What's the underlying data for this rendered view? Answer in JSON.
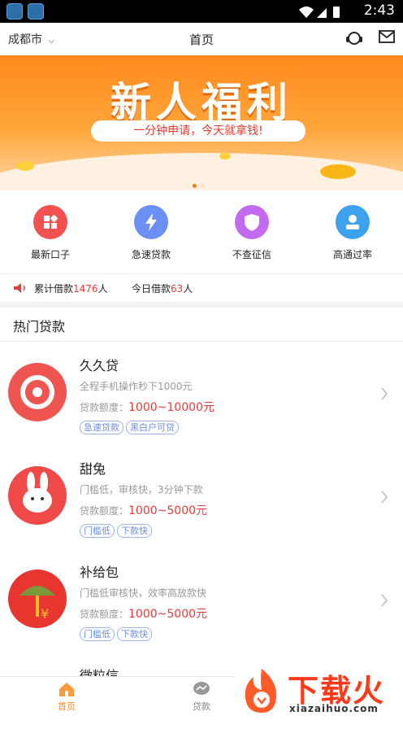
{
  "status_bar": {
    "time": "2:43"
  },
  "header": {
    "city": "成都市",
    "title": "首页"
  },
  "banner": {
    "title": "新人福利",
    "subtitle": "一分钟申请，今天就拿钱!"
  },
  "quick_links": [
    {
      "label": "最新口子",
      "color": "#f2514f"
    },
    {
      "label": "急速贷款",
      "color": "#6b8ff2"
    },
    {
      "label": "不查征信",
      "color": "#c36bf0"
    },
    {
      "label": "高通过率",
      "color": "#3da2ee"
    }
  ],
  "ticker": {
    "total_prefix": "累计借款",
    "total_count": "1476",
    "total_suffix": "人",
    "today_prefix": "今日借款",
    "today_count": "63",
    "today_suffix": "人"
  },
  "hot": {
    "title": "热门贷款",
    "amount_label": "贷款额度：",
    "items": [
      {
        "name": "久久贷",
        "desc": "全程手机操作秒下1000元",
        "amount": "1000~10000元",
        "tags": [
          "急速贷款",
          "黑白户可贷"
        ]
      },
      {
        "name": "甜兔",
        "desc": "门槛低，审核快，3分钟下款",
        "amount": "1000~5000元",
        "tags": [
          "门槛低",
          "下款快"
        ]
      },
      {
        "name": "补给包",
        "desc": "门槛低审核快，效率高放款快",
        "amount": "1000~5000元",
        "tags": [
          "门槛低",
          "下款快"
        ]
      },
      {
        "name": "微粒信"
      }
    ]
  },
  "tabbar": {
    "home": "首页",
    "loan": "贷款"
  },
  "watermark": {
    "brand": "下载火",
    "domain": "xiazaihuo.com"
  },
  "colors": {
    "accent": "#ff8a1f",
    "price": "#e93a3a",
    "tag": "#6a8ed8"
  }
}
